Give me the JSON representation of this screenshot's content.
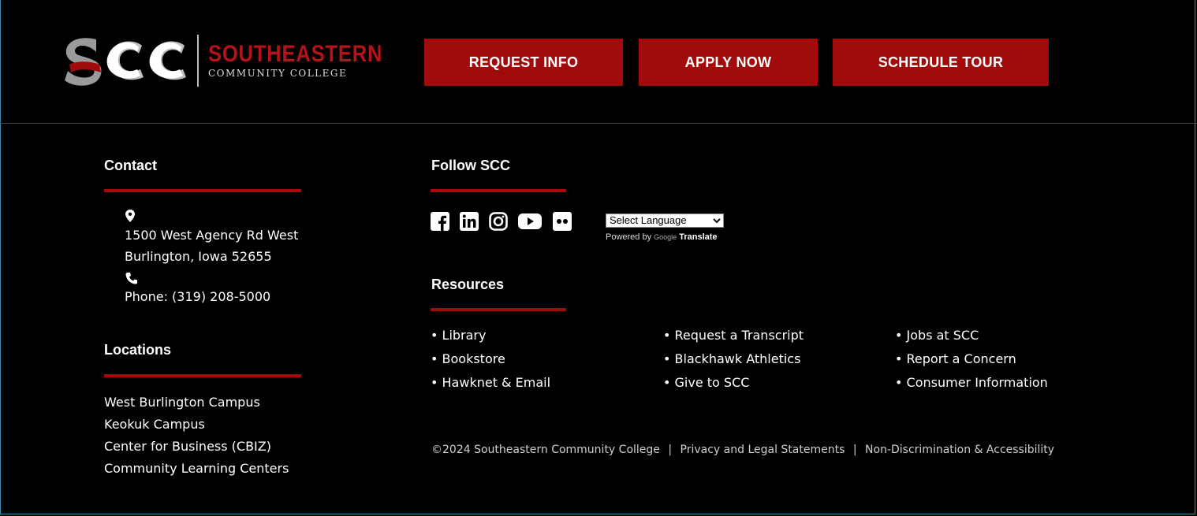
{
  "logo": {
    "mark": "SCC",
    "title": "SOUTHEASTERN",
    "subtitle": "COMMUNITY COLLEGE"
  },
  "cta": {
    "request_info": "REQUEST INFO",
    "apply_now": "APPLY NOW",
    "schedule_tour": "SCHEDULE TOUR"
  },
  "contact": {
    "heading": "Contact",
    "address_line1": "1500 West Agency Rd West",
    "address_line2": "Burlington, Iowa 52655",
    "phone": "Phone: (319) 208-5000"
  },
  "locations": {
    "heading": "Locations",
    "items": [
      "West Burlington Campus",
      "Keokuk Campus",
      "Center for Business (CBIZ)",
      "Community Learning Centers"
    ]
  },
  "follow": {
    "heading": "Follow SCC",
    "icons": [
      "facebook-icon",
      "linkedin-icon",
      "instagram-icon",
      "youtube-icon",
      "flickr-icon"
    ]
  },
  "translate": {
    "select_value": "Select Language",
    "powered_by": "Powered by",
    "google": "Google",
    "translate": "Translate"
  },
  "resources": {
    "heading": "Resources",
    "col1": [
      "• Library",
      "• Bookstore",
      "• Hawknet & Email"
    ],
    "col2": [
      "• Request a Transcript",
      "• Blackhawk Athletics",
      "• Give to SCC"
    ],
    "col3": [
      "• Jobs at SCC",
      "• Report a Concern",
      "• Consumer Information"
    ]
  },
  "legal": {
    "copyright": "©2024 Southeastern Community College",
    "separator": "|",
    "privacy": "Privacy and Legal Statements",
    "nondiscrimination": "Non-Discrimination & Accessibility"
  },
  "colors": {
    "brand_red": "#a10b0b",
    "background": "#000000"
  }
}
